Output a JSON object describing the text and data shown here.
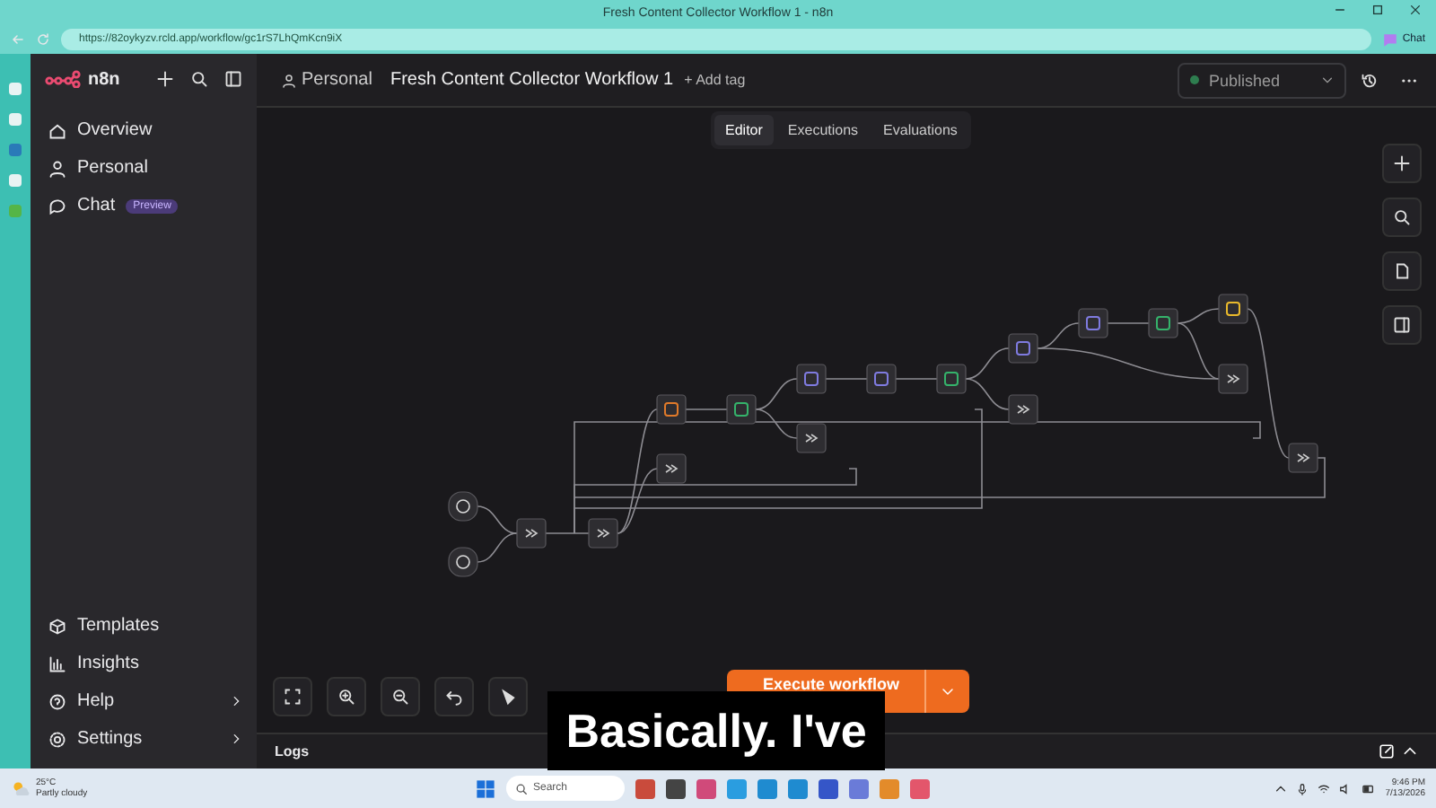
{
  "browser": {
    "tab_title": "Fresh Content Collector Workflow 1 - n8n",
    "url": "https://82oykyzv.rcld.app/workflow/gc1rS7LhQmKcn9iX",
    "chat_label": "Chat"
  },
  "sidebar": {
    "brand": "n8n",
    "items": [
      {
        "kind": "home",
        "label": "Overview"
      },
      {
        "kind": "user",
        "label": "Personal"
      },
      {
        "kind": "chat",
        "label": "Chat",
        "badge": "Preview"
      }
    ],
    "bottom_items": [
      {
        "kind": "templates",
        "label": "Templates",
        "arrow": false
      },
      {
        "kind": "insights",
        "label": "Insights",
        "arrow": false
      },
      {
        "kind": "help",
        "label": "Help",
        "arrow": true
      },
      {
        "kind": "settings",
        "label": "Settings",
        "arrow": true
      }
    ]
  },
  "header": {
    "project": "Personal",
    "workflow_title": "Fresh Content Collector Workflow 1",
    "add_tag": "+ Add tag",
    "publish_state": "Published"
  },
  "tabs": [
    {
      "label": "Editor",
      "selected": true
    },
    {
      "label": "Executions",
      "selected": false
    },
    {
      "label": "Evaluations",
      "selected": false
    }
  ],
  "execute_button": {
    "label": "Execute workflow"
  },
  "logs": {
    "label": "Logs"
  },
  "subtitle": "Basically. I've",
  "taskbar": {
    "temperature": "25°C",
    "weather": "Partly cloudy",
    "search_placeholder": "Search",
    "time": "9:46 PM",
    "date": "7/13/2026"
  }
}
